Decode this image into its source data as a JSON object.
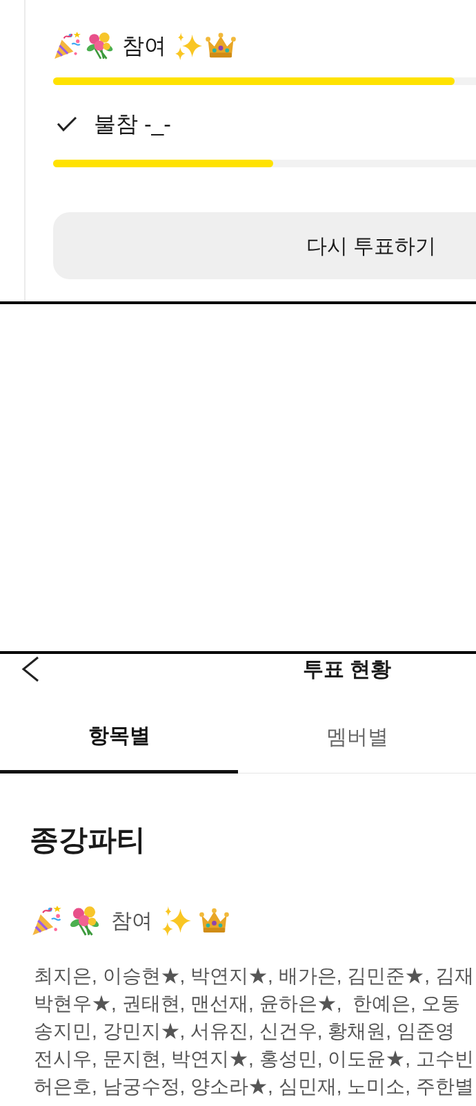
{
  "vote_card": {
    "options": [
      {
        "label": "참여",
        "decorated": true,
        "checked": false,
        "level": 0.95
      },
      {
        "label": "불참 -_-",
        "decorated": false,
        "checked": true,
        "level": 0.52
      }
    ],
    "revote_button": "다시 투표하기"
  },
  "status_screen": {
    "title": "투표 현황",
    "tabs": [
      {
        "label": "항목별",
        "selected": true
      },
      {
        "label": "멤버별",
        "selected": false
      }
    ],
    "vote_title": "종강파티",
    "option": {
      "label": "참여",
      "decorated": true
    },
    "voter_lines": [
      "최지은, 이승현★, 박연지★, 배가은, 김민준★, 김재",
      "박현우★, 권태현, 맨선재, 윤하은★,  한예은, 오동",
      "송지민, 강민지★, 서유진, 신건우, 황채원, 임준영",
      "전시우, 문지현, 박연지★, 홍성민, 이도윤★, 고수빈",
      "허은호, 남궁수정, 양소라★, 심민재, 노미소, 주한별"
    ]
  }
}
